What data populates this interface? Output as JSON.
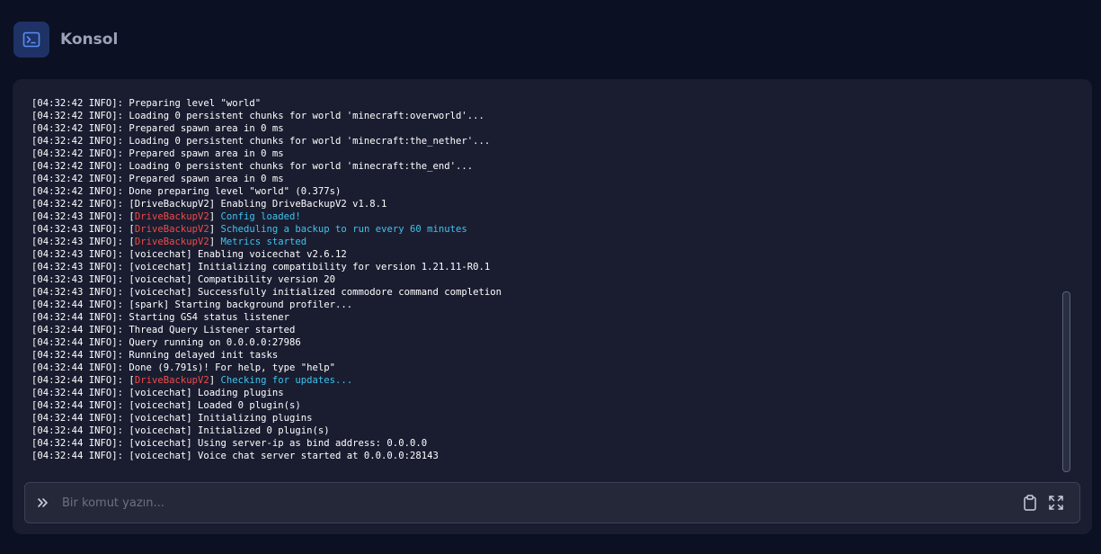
{
  "header": {
    "title": "Konsol",
    "icon": "terminal-icon",
    "icon_bg": "#1e3266",
    "icon_color": "#5b8df0"
  },
  "console": {
    "colors": {
      "default": "#ffffff",
      "plugin_tag": "#ee4b4b",
      "plugin_msg": "#3fc3ee"
    },
    "lines": [
      [
        {
          "t": "[04:32:42 INFO]: Preparing level \"world\""
        }
      ],
      [
        {
          "t": "[04:32:42 INFO]: Loading 0 persistent chunks for world 'minecraft:overworld'..."
        }
      ],
      [
        {
          "t": "[04:32:42 INFO]: Prepared spawn area in 0 ms"
        }
      ],
      [
        {
          "t": "[04:32:42 INFO]: Loading 0 persistent chunks for world 'minecraft:the_nether'..."
        }
      ],
      [
        {
          "t": "[04:32:42 INFO]: Prepared spawn area in 0 ms"
        }
      ],
      [
        {
          "t": "[04:32:42 INFO]: Loading 0 persistent chunks for world 'minecraft:the_end'..."
        }
      ],
      [
        {
          "t": "[04:32:42 INFO]: Prepared spawn area in 0 ms"
        }
      ],
      [
        {
          "t": "[04:32:42 INFO]: Done preparing level \"world\" (0.377s)"
        }
      ],
      [
        {
          "t": "[04:32:42 INFO]: [DriveBackupV2] Enabling DriveBackupV2 v1.8.1"
        }
      ],
      [
        {
          "t": "[04:32:43 INFO]: ["
        },
        {
          "t": "DriveBackupV2",
          "c": "red"
        },
        {
          "t": "] "
        },
        {
          "t": "Config loaded!",
          "c": "cyan"
        }
      ],
      [
        {
          "t": "[04:32:43 INFO]: ["
        },
        {
          "t": "DriveBackupV2",
          "c": "red"
        },
        {
          "t": "] "
        },
        {
          "t": "Scheduling a backup to run every 60 minutes",
          "c": "cyan"
        }
      ],
      [
        {
          "t": "[04:32:43 INFO]: ["
        },
        {
          "t": "DriveBackupV2",
          "c": "red"
        },
        {
          "t": "] "
        },
        {
          "t": "Metrics started",
          "c": "cyan"
        }
      ],
      [
        {
          "t": "[04:32:43 INFO]: [voicechat] Enabling voicechat v2.6.12"
        }
      ],
      [
        {
          "t": "[04:32:43 INFO]: [voicechat] Initializing compatibility for version 1.21.11-R0.1"
        }
      ],
      [
        {
          "t": "[04:32:43 INFO]: [voicechat] Compatibility version 20"
        }
      ],
      [
        {
          "t": "[04:32:43 INFO]: [voicechat] Successfully initialized commodore command completion"
        }
      ],
      [
        {
          "t": "[04:32:44 INFO]: [spark] Starting background profiler..."
        }
      ],
      [
        {
          "t": "[04:32:44 INFO]: Starting GS4 status listener"
        }
      ],
      [
        {
          "t": "[04:32:44 INFO]: Thread Query Listener started"
        }
      ],
      [
        {
          "t": "[04:32:44 INFO]: Query running on 0.0.0.0:27986"
        }
      ],
      [
        {
          "t": "[04:32:44 INFO]: Running delayed init tasks"
        }
      ],
      [
        {
          "t": "[04:32:44 INFO]: Done (9.791s)! For help, type \"help\""
        }
      ],
      [
        {
          "t": "[04:32:44 INFO]: ["
        },
        {
          "t": "DriveBackupV2",
          "c": "red"
        },
        {
          "t": "] "
        },
        {
          "t": "Checking for updates...",
          "c": "cyan"
        }
      ],
      [
        {
          "t": "[04:32:44 INFO]: [voicechat] Loading plugins"
        }
      ],
      [
        {
          "t": "[04:32:44 INFO]: [voicechat] Loaded 0 plugin(s)"
        }
      ],
      [
        {
          "t": "[04:32:44 INFO]: [voicechat] Initializing plugins"
        }
      ],
      [
        {
          "t": "[04:32:44 INFO]: [voicechat] Initialized 0 plugin(s)"
        }
      ],
      [
        {
          "t": "[04:32:44 INFO]: [voicechat] Using server-ip as bind address: 0.0.0.0"
        }
      ],
      [
        {
          "t": "[04:32:44 INFO]: [voicechat] Voice chat server started at 0.0.0.0:28143"
        }
      ]
    ]
  },
  "input": {
    "value": "",
    "placeholder": "Bir komut yazın...",
    "prompt_icon": "double-chevron-right-icon",
    "actions": [
      {
        "name": "clipboard-icon"
      },
      {
        "name": "expand-icon"
      }
    ]
  }
}
